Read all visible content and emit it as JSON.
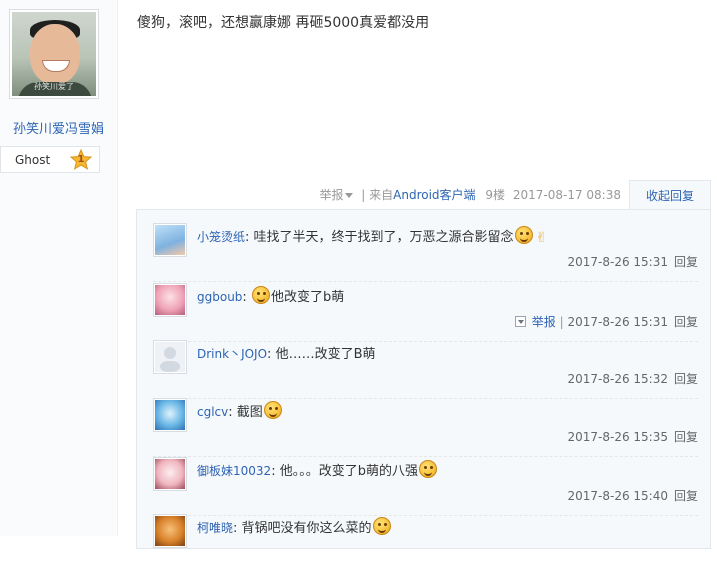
{
  "author": {
    "name": "孙笑川爱冯雪娟",
    "avatar_watermark": "孙笑川爱了",
    "badge_label": "Ghost",
    "badge_level": "1"
  },
  "post": {
    "content": "傻狗，滚吧，还想赢康娜 再砸5000真爱都没用"
  },
  "post_tail": {
    "report": "举报",
    "from": "来自",
    "client": "Android客户端",
    "floor": "9楼",
    "timestamp": "2017-08-17 08:38",
    "collapse": "收起回复"
  },
  "replies": [
    {
      "user": "小笼烫纸",
      "text": "哇找了半天，终于找到了，万恶之源合影留念",
      "time": "2017-8-26 15:31",
      "reply": "回复",
      "emoji_pos": "end",
      "avatar_color": "#9fc7ea"
    },
    {
      "user": "ggboub",
      "text": "他改变了b萌",
      "time": "2017-8-26 15:31",
      "reply": "回复",
      "report": "举报",
      "emoji_pos": "start",
      "avatar_color": "#f2b6c4"
    },
    {
      "user": "Drink丶JOJO",
      "text": "他……改变了B萌",
      "time": "2017-8-26 15:32",
      "reply": "回复",
      "emoji_pos": "none",
      "avatar_color": "#e8ecf2"
    },
    {
      "user": "cglcv",
      "text": "截图",
      "time": "2017-8-26 15:35",
      "reply": "回复",
      "emoji_pos": "end",
      "avatar_color": "#6fb6e6"
    },
    {
      "user": "御板妹10032",
      "text": "他。。。改变了b萌的八强",
      "time": "2017-8-26 15:40",
      "reply": "回复",
      "emoji_pos": "end",
      "avatar_color": "#f0c2c8"
    },
    {
      "user": "柯唯晓",
      "text": "背锅吧没有你这么菜的",
      "time": "",
      "reply": "",
      "emoji_pos": "end",
      "avatar_color": "#d9822b"
    }
  ],
  "colors": {
    "link_blue": "#2d64b3",
    "muted": "#999999",
    "reply_bg": "#f6f9fc",
    "star": "#f5b82e"
  },
  "icons": {
    "emoji": "smile-emoji-icon",
    "victory": "victory-hand-icon",
    "dropdown": "chevron-down-icon",
    "star": "star-icon"
  }
}
